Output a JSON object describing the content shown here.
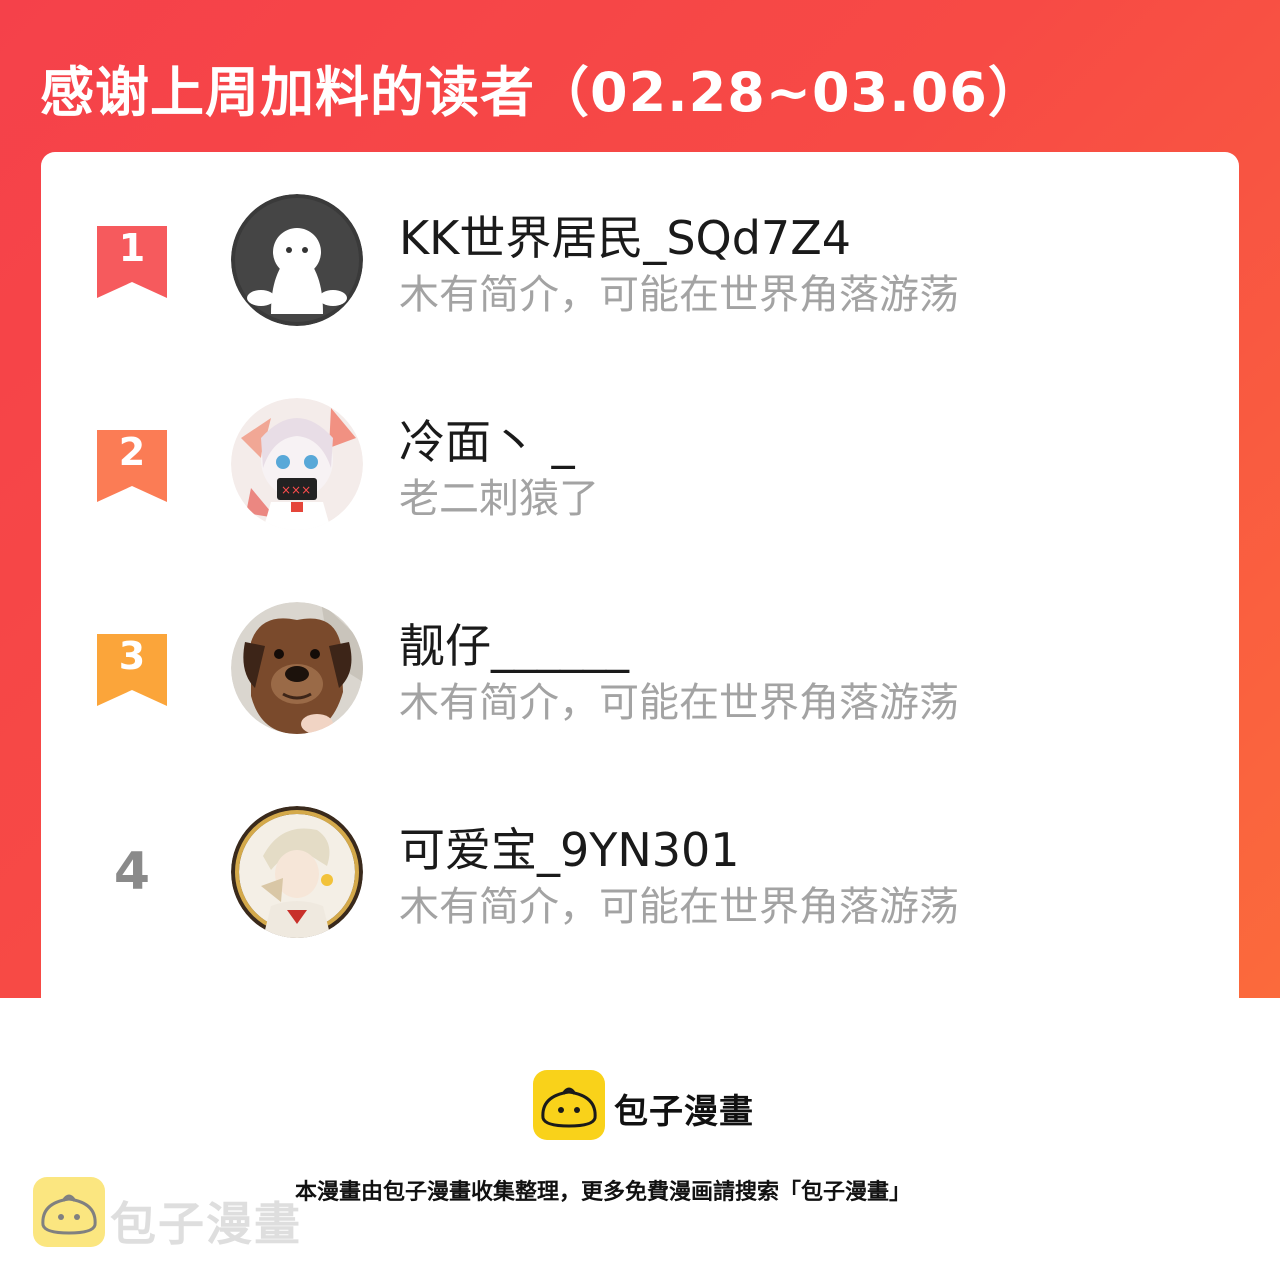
{
  "header": {
    "title": "感谢上周加料的读者（02.28~03.06）"
  },
  "colors": {
    "banner": "#f5414a",
    "rank1": "#f65a5d",
    "rank2": "#fb7c55",
    "rank3": "#fba53a",
    "brand_yellow": "#f9d21a"
  },
  "readers": [
    {
      "rank": "1",
      "name": "KK世界居民_SQd7Z4",
      "bio": "木有简介，可能在世界角落游荡",
      "avatar": "default-ghost-avatar"
    },
    {
      "rank": "2",
      "name": "冷面丶 _",
      "bio": "老二刺猿了",
      "avatar": "anime-girl-avatar"
    },
    {
      "rank": "3",
      "name": "靓仔______",
      "bio": "木有简介，可能在世界角落游荡",
      "avatar": "dog-photo-avatar"
    },
    {
      "rank": "4",
      "name": "可爱宝_9YN301",
      "bio": "木有简介，可能在世界角落游荡",
      "avatar": "anime-character-avatar"
    }
  ],
  "footer": {
    "brand": "包子漫畫",
    "note": "本漫畫由包子漫畫收集整理，更多免費漫画請搜索「包子漫畫」",
    "watermark": "包子漫畫"
  }
}
